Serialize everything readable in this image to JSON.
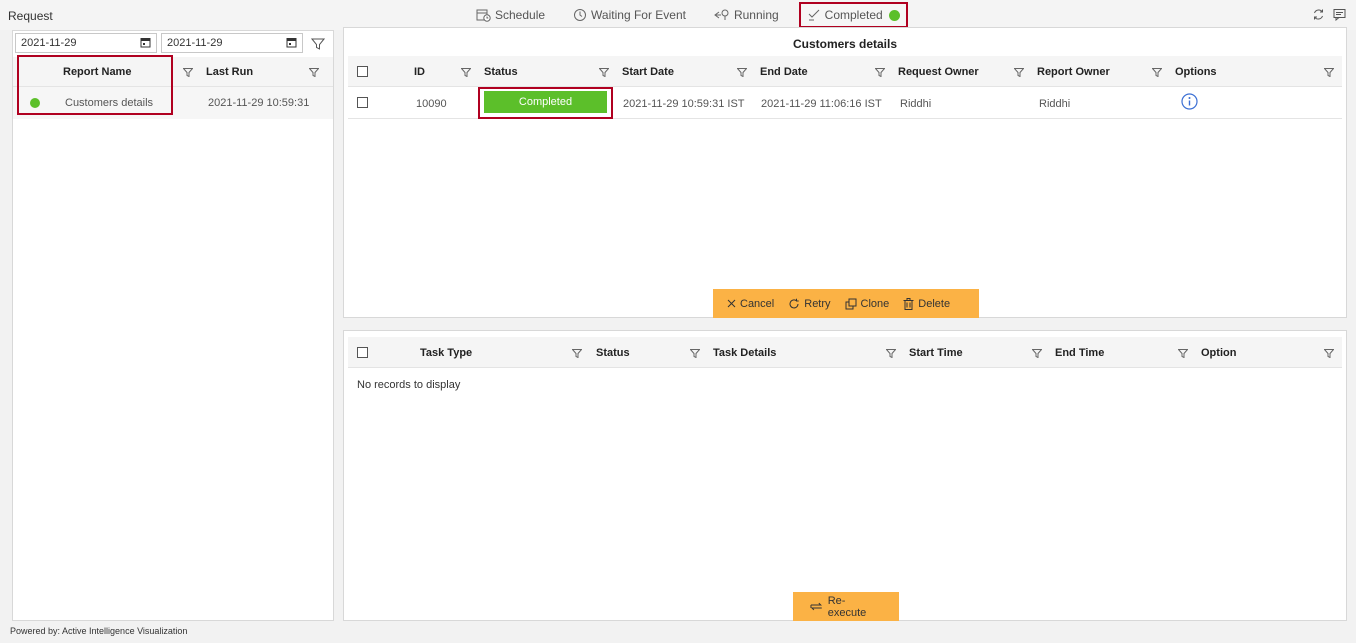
{
  "app": {
    "title": "Request"
  },
  "tabs": [
    {
      "label": "Schedule",
      "icon": "calendar-clock-icon"
    },
    {
      "label": "Waiting For Event",
      "icon": "timer-icon"
    },
    {
      "label": "Running",
      "icon": "running-icon"
    },
    {
      "label": "Completed",
      "icon": "check-icon",
      "active": true,
      "indicator_color": "#5cbf2a"
    }
  ],
  "reports": {
    "from_date": "2021-11-29",
    "to_date": "2021-11-29",
    "columns": [
      "Report Name",
      "Last Run"
    ],
    "rows": [
      {
        "status_color": "#5cbf2a",
        "name": "Customers details",
        "last_run": "2021-11-29 10:59:31"
      }
    ]
  },
  "requests": {
    "title": "Customers details",
    "columns": [
      "ID",
      "Status",
      "Start Date",
      "End Date",
      "Request Owner",
      "Report Owner",
      "Options"
    ],
    "rows": [
      {
        "id": "10090",
        "status": "Completed",
        "start": "2021-11-29 10:59:31 IST",
        "end": "2021-11-29 11:06:16 IST",
        "request_owner": "Riddhi",
        "report_owner": "Riddhi",
        "option_icon": "info-icon"
      }
    ],
    "actions": [
      "Cancel",
      "Retry",
      "Clone",
      "Delete"
    ]
  },
  "tasks": {
    "columns": [
      "Task Type",
      "Status",
      "Task Details",
      "Start Time",
      "End Time",
      "Option"
    ],
    "empty_text": "No records to display",
    "action": "Re-execute"
  },
  "footer": {
    "text": "Powered by: Active Intelligence Visualization"
  },
  "colors": {
    "accent_orange": "#fbb245",
    "status_green": "#5cbf2a",
    "highlight_red": "#b00020"
  }
}
